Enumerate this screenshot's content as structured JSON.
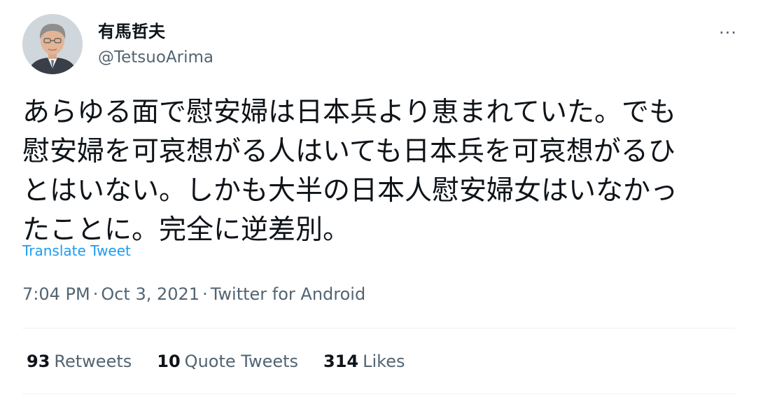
{
  "author": {
    "name": "有馬哲夫",
    "handle": "@TetsuoArima"
  },
  "more_button": {
    "label": "···"
  },
  "tweet": {
    "lines": [
      "あらゆる面で慰安婦は日本兵より恵まれていた。でも",
      "慰安婦を可哀想がる人はいても日本兵を可哀想がるひ",
      "とはいない。しかも大半の日本人慰安婦女はいなかっ",
      "たことに。完全に逆差別。"
    ],
    "translate_label": "Translate Tweet"
  },
  "meta": {
    "time": "7:04 PM",
    "separator": "·",
    "date": "Oct 3, 2021",
    "source": "Twitter for Android"
  },
  "stats": {
    "retweets": {
      "count": "93",
      "label": "Retweets"
    },
    "quotes": {
      "count": "10",
      "label": "Quote Tweets"
    },
    "likes": {
      "count": "314",
      "label": "Likes"
    }
  },
  "icons": {
    "avatar": "avatar-portrait",
    "more": "more-dots-icon"
  },
  "colors": {
    "text": "#0f1419",
    "secondary": "#536471",
    "link": "#1d9bf0",
    "divider": "#eff3f4"
  }
}
